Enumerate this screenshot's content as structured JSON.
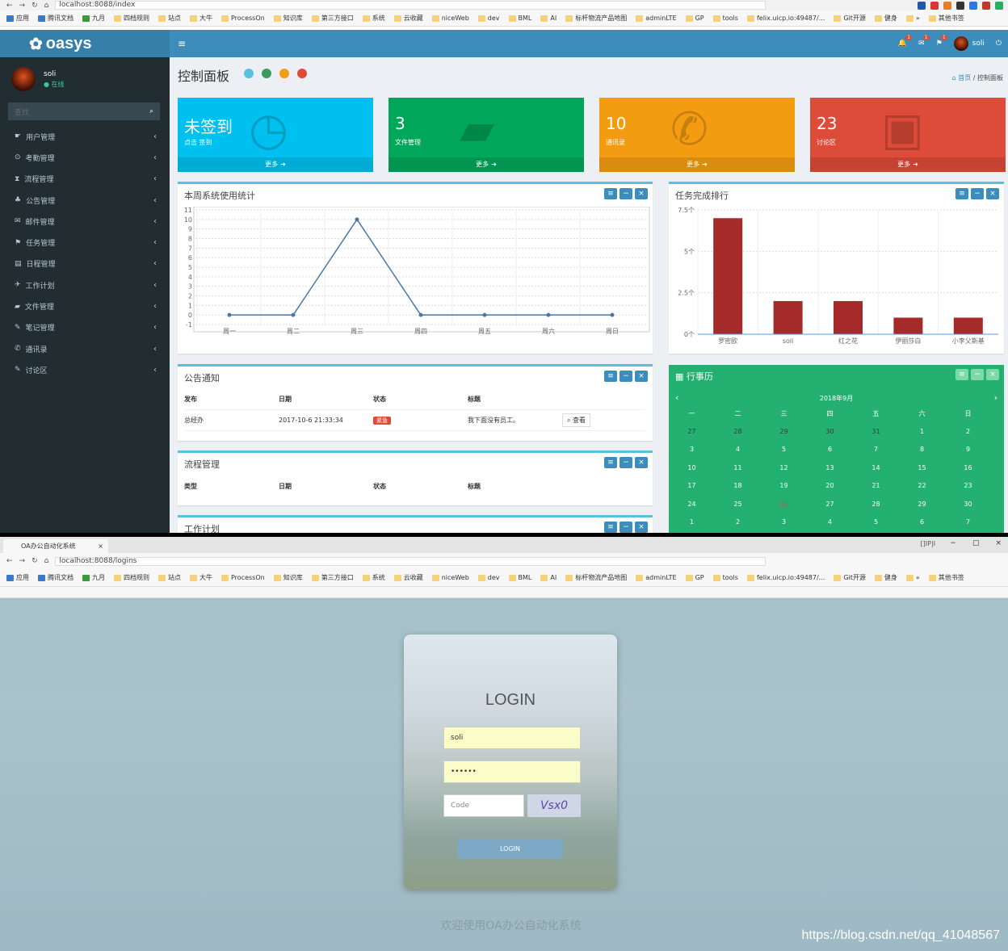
{
  "browser1": {
    "url": "localhost:8088/index"
  },
  "browser2": {
    "url": "localhost:8088/logins",
    "tab_title": "OA办公自动化系统",
    "ext_text": "[]IP|I"
  },
  "bookmarks": [
    "应用",
    "腾讯文档",
    "九月",
    "四档规则",
    "站点",
    "大牛",
    "ProcessOn",
    "知识库",
    "第三方接口",
    "系统",
    "云收藏",
    "niceWeb",
    "dev",
    "BML",
    "AI",
    "标杆物流产品地图",
    "adminLTE",
    "GP",
    "tools",
    "felix.uicp.io:49487/...",
    "Git开源",
    "健身",
    "»",
    "其他书签"
  ],
  "app": {
    "logo": "oasys",
    "user_name": "soli",
    "user_status": "在线",
    "search_placeholder": "查找",
    "menu": [
      "用户管理",
      "考勤管理",
      "流程管理",
      "公告管理",
      "邮件管理",
      "任务管理",
      "日程管理",
      "工作计划",
      "文件管理",
      "笔记管理",
      "通讯录",
      "讨论区"
    ],
    "top_user": "soli",
    "badges": [
      "1",
      "1",
      "1"
    ]
  },
  "page": {
    "title": "控制面板",
    "crumb_home": "首页",
    "crumb_current": "控制面板"
  },
  "tiles": [
    {
      "num": "未签到",
      "label": "点击 签到",
      "more": "更多",
      "color": "#00c0ef"
    },
    {
      "num": "3",
      "label": "文件管理",
      "more": "更多",
      "color": "#00a65a"
    },
    {
      "num": "10",
      "label": "通讯录",
      "more": "更多",
      "color": "#f39c12"
    },
    {
      "num": "23",
      "label": "讨论区",
      "more": "更多",
      "color": "#dd4b39"
    }
  ],
  "panels": {
    "stats": "本周系统使用统计",
    "rank": "任务完成排行",
    "notice": "公告通知",
    "flow": "流程管理",
    "plan": "工作计划",
    "calendar": "行事历"
  },
  "notice_table": {
    "headers": [
      "发布",
      "日期",
      "状态",
      "标题"
    ],
    "row": [
      "总经办",
      "2017-10-6 21:33:34",
      "紧急",
      "我下面没有员工。",
      "查看"
    ]
  },
  "flow_table": {
    "headers": [
      "类型",
      "日期",
      "状态",
      "标题"
    ]
  },
  "calendar": {
    "month": "2018年9月",
    "weekdays": [
      "一",
      "二",
      "三",
      "四",
      "五",
      "六",
      "日"
    ],
    "weeks": [
      [
        "27",
        "28",
        "29",
        "30",
        "31",
        "1",
        "2"
      ],
      [
        "3",
        "4",
        "5",
        "6",
        "7",
        "8",
        "9"
      ],
      [
        "10",
        "11",
        "12",
        "13",
        "14",
        "15",
        "16"
      ],
      [
        "17",
        "18",
        "19",
        "20",
        "21",
        "22",
        "23"
      ],
      [
        "24",
        "25",
        "26",
        "27",
        "28",
        "29",
        "30"
      ],
      [
        "1",
        "2",
        "3",
        "4",
        "5",
        "6",
        "7"
      ]
    ]
  },
  "chart_data": [
    {
      "type": "line",
      "title": "本周系统使用统计",
      "categories": [
        "周一",
        "周二",
        "周三",
        "周四",
        "周五",
        "周六",
        "周日"
      ],
      "values": [
        0,
        0,
        10,
        0,
        0,
        0,
        0
      ],
      "ylim": [
        -1,
        11
      ],
      "yticks": [
        "11",
        "10",
        "9",
        "8",
        "7",
        "6",
        "5",
        "4",
        "3",
        "2",
        "1",
        "0",
        "-1"
      ]
    },
    {
      "type": "bar",
      "title": "任务完成排行",
      "categories": [
        "罗密欧",
        "soli",
        "红之花",
        "伊丽莎白",
        "小李父斯基"
      ],
      "values": [
        7,
        2,
        2,
        1,
        1
      ],
      "ylim": [
        0,
        7.5
      ],
      "yticks": [
        "7.5个",
        "5个",
        "2.5个",
        "0个"
      ],
      "color": "#a52a2a"
    }
  ],
  "login": {
    "title": "LOGIN",
    "username": "soli",
    "password": "••••••",
    "code_placeholder": "Code",
    "captcha": "Vsx0",
    "button": "LOGIN",
    "welcome": "欢迎使用OA办公自动化系统",
    "watermark": "https://blog.csdn.net/qq_41048567"
  }
}
